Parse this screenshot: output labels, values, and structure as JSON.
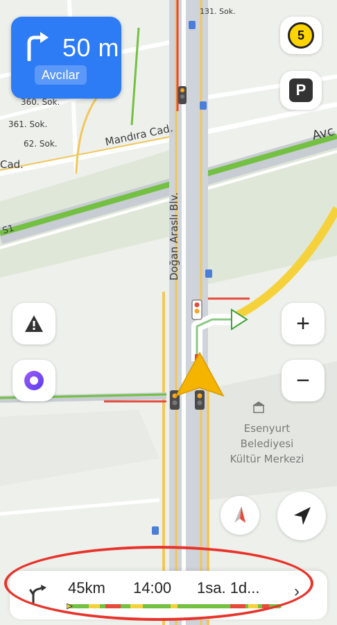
{
  "maneuver": {
    "distance": "50 m",
    "street": "Avcılar",
    "icon": "turn-right-icon"
  },
  "map": {
    "street_labels": {
      "sok_131": "131. Sok.",
      "sok_360": "360. Sok.",
      "sok_361": "361. Sok.",
      "sok_362": "62. Sok.",
      "mandira": "Mandıra Cad.",
      "cad_left": "Cad.",
      "dogan": "Doğan Araslı Blv.",
      "avc": "Avc",
      "s1": "S1"
    },
    "poi": {
      "line1": "Esenyurt",
      "line2": "Belediyesi",
      "line3": "Kültür Merkezi"
    }
  },
  "controls": {
    "speed_limit": "5",
    "parking_label": "P",
    "zoom_in": "+",
    "zoom_out": "−",
    "alert_icon": "warning-icon",
    "assistant_icon": "alice-assistant-icon",
    "compass_icon": "compass-icon",
    "locate_icon": "navigation-arrow-icon"
  },
  "route_summary": {
    "distance": "45km",
    "arrival": "14:00",
    "duration": "1sa. 1d...",
    "more": "›"
  },
  "colors": {
    "accent_blue": "#2d7cf6",
    "traffic_green": "#74c043",
    "traffic_yellow": "#f5d23c",
    "traffic_red": "#e64a3b",
    "highlight_red": "#e8332a"
  }
}
